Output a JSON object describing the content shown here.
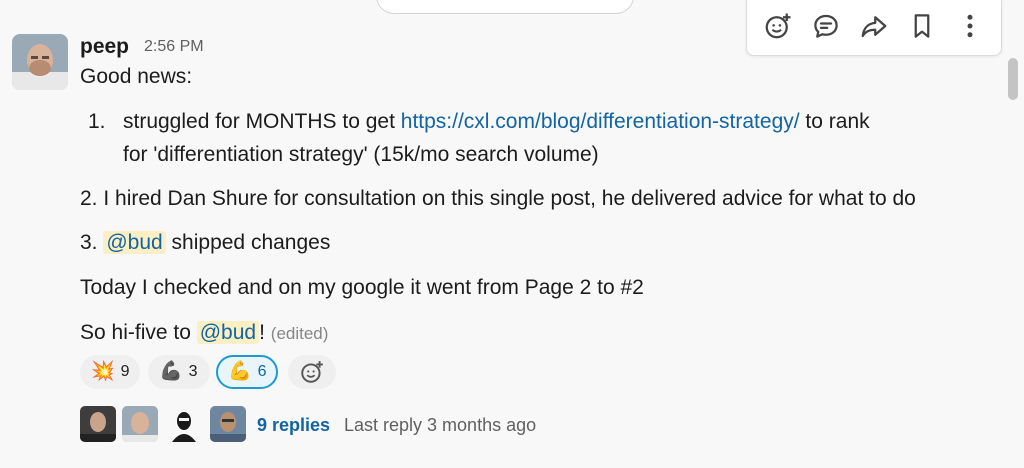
{
  "message": {
    "author": "peep",
    "timestamp": "2:56 PM",
    "lines": {
      "intro": "Good news:",
      "item1_number": "1.",
      "item1_before": "struggled for MONTHS to get ",
      "item1_link": "https://cxl.com/blog/differentiation-strategy/",
      "item1_after": " to rank",
      "item1_cont": "for 'differentiation strategy' (15k/mo search volume)",
      "item2": "2. I hired Dan Shure for consultation on this single post, he delivered advice for what to do",
      "item3_prefix": "3. ",
      "item3_mention": "@bud",
      "item3_suffix": " shipped changes",
      "today": "Today I checked and on my google it went from Page 2 to #2",
      "hifive_prefix": "So hi-five to ",
      "hifive_mention": "@bud",
      "hifive_suffix": "!",
      "edited": "(edited)"
    }
  },
  "reactions": [
    {
      "emoji": "💥",
      "count": "9",
      "active": false
    },
    {
      "emoji": "💪",
      "count": "3",
      "active": false
    },
    {
      "emoji": "💪",
      "count": "6",
      "active": true
    }
  ],
  "thread": {
    "replies_label": "9 replies",
    "last_reply": "Last reply 3 months ago"
  },
  "toolbar_icons": [
    "add-reaction-icon",
    "reply-in-thread-icon",
    "share-icon",
    "bookmark-icon",
    "more-actions-icon"
  ],
  "colors": {
    "background": "#f8f8f8",
    "link": "#1264a3",
    "mention_bg": "#fcefc4",
    "active_reaction_border": "#1d9bd1"
  }
}
